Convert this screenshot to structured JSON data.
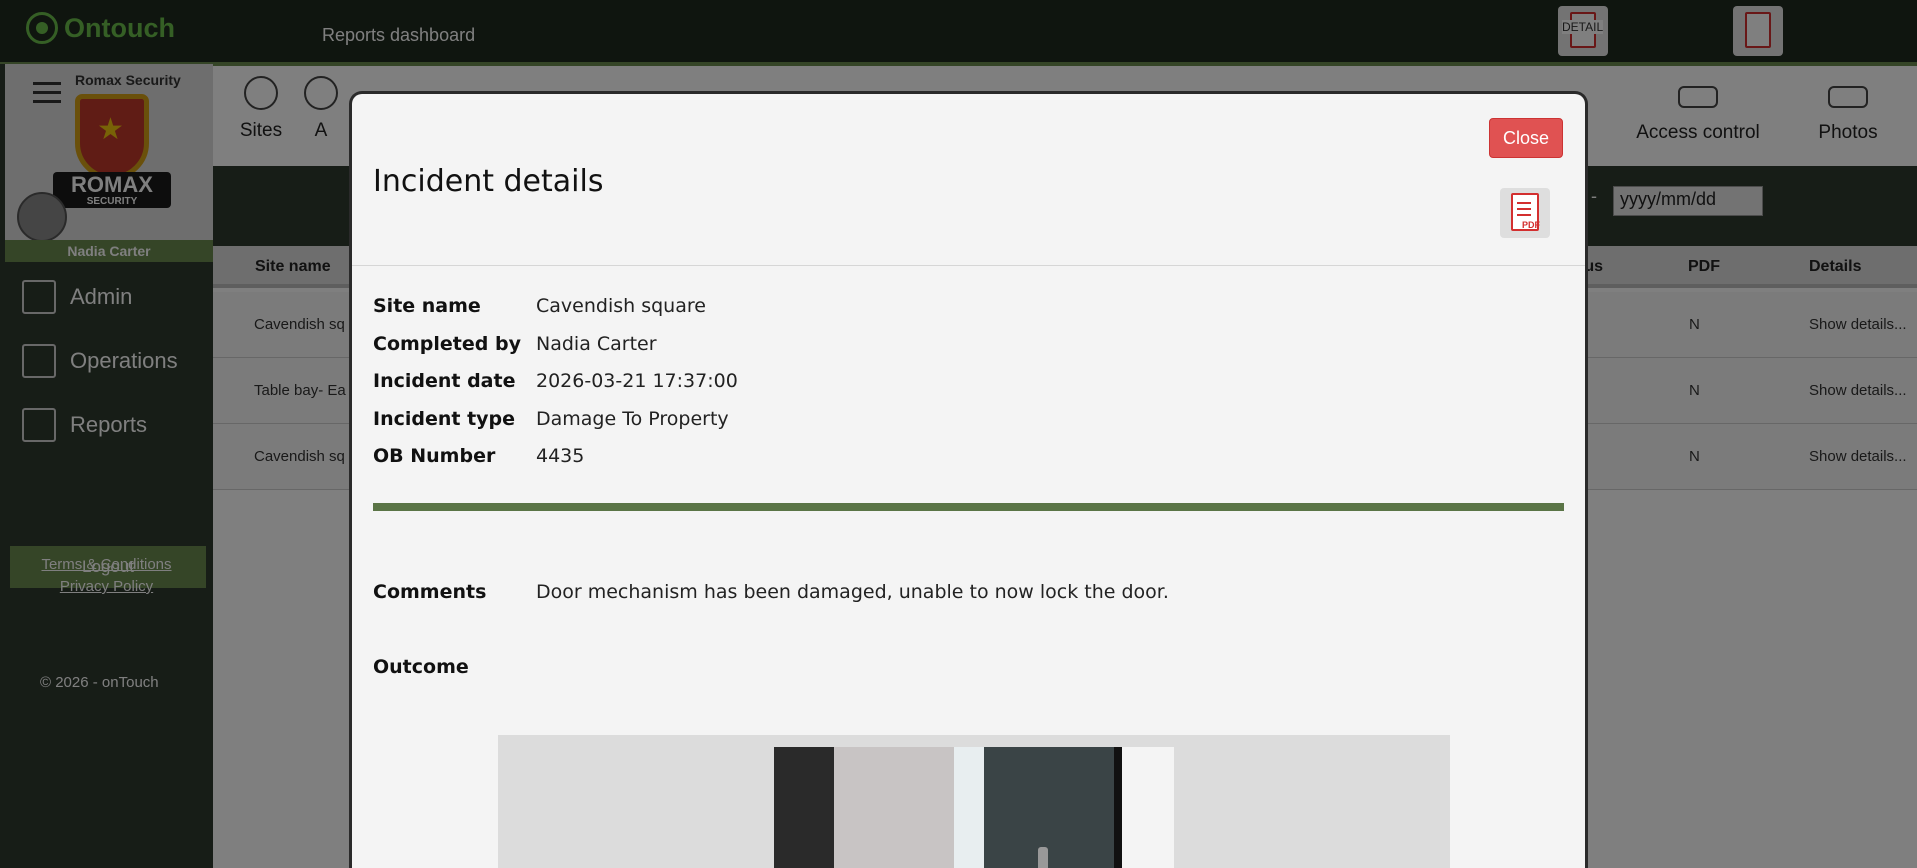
{
  "topbar": {
    "brand": "Ontouch",
    "title": "Reports dashboard",
    "detail_pdf_label": "DETAIL",
    "pdf_label": "PDF"
  },
  "sidebar": {
    "company": "Romax Security",
    "crest_text": "ROMAX",
    "crest_subtext": "SECURITY",
    "user_name": "Nadia Carter",
    "items": [
      {
        "label": "Admin",
        "icon": "clipboard-icon"
      },
      {
        "label": "Operations",
        "icon": "buildings-icon"
      },
      {
        "label": "Reports",
        "icon": "bar-chart-icon"
      }
    ],
    "logout_label": "Logout",
    "terms_label": "Terms & Conditions",
    "privacy_label": "Privacy Policy",
    "copyright": "© 2026 - onTouch"
  },
  "tabs": [
    {
      "label": "Sites",
      "icon": "map-pin-icon"
    },
    {
      "label": "A",
      "icon": "user-icon"
    },
    {
      "label": "Access control",
      "icon": "car-icon"
    },
    {
      "label": "Photos",
      "icon": "camera-icon"
    }
  ],
  "filters": {
    "date_placeholder": "yyyy/mm/dd",
    "date_separator": "-"
  },
  "table": {
    "headers": {
      "site_name": "Site name",
      "status": "tus",
      "pdf": "PDF",
      "details": "Details"
    },
    "rows": [
      {
        "site": "Cavendish sq",
        "pdf": "N",
        "details": "Show details..."
      },
      {
        "site": "Table bay- Ea",
        "pdf": "N",
        "details": "Show details..."
      },
      {
        "site": "Cavendish sq",
        "pdf": "N",
        "details": "Show details..."
      }
    ]
  },
  "modal": {
    "close_label": "Close",
    "title": "Incident details",
    "pdf_label": "PDF",
    "fields": [
      {
        "label": "Site name",
        "value": "Cavendish square"
      },
      {
        "label": "Completed by",
        "value": "Nadia Carter"
      },
      {
        "label": "Incident date",
        "value": "2026-03-21 17:37:00"
      },
      {
        "label": "Incident type",
        "value": "Damage To Property"
      },
      {
        "label": "OB Number",
        "value": "4435"
      }
    ],
    "comments_label": "Comments",
    "comments_value": "Door mechanism has been damaged, unable to now lock the door.",
    "outcome_label": "Outcome",
    "outcome_value": ""
  },
  "colors": {
    "brand_green": "#6abf4b",
    "accent_green": "#5a7446",
    "close_red": "#e05252",
    "pdf_red": "#d32f2f"
  }
}
